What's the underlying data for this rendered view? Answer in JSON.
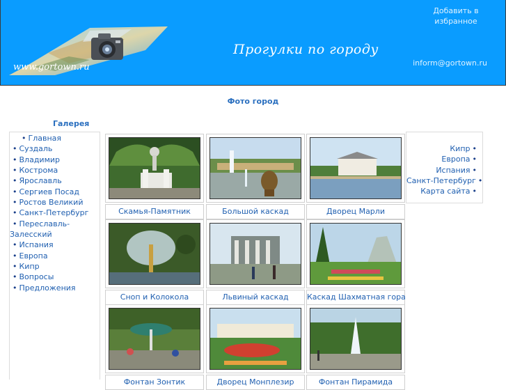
{
  "header": {
    "logo_text": "www.gortown.ru",
    "site_title": "Прогулки по городу",
    "favorite_link": "Добавить в избранное",
    "email_link": "inform@gortown.ru"
  },
  "main": {
    "page_heading": "Фото город",
    "gallery_heading": "Галерея"
  },
  "left_nav": {
    "items": [
      {
        "label": "Главная"
      },
      {
        "label": "Суздаль"
      },
      {
        "label": "Владимир"
      },
      {
        "label": "Кострома"
      },
      {
        "label": "Ярославль"
      },
      {
        "label": "Сергиев Посад"
      },
      {
        "label": "Ростов Великий"
      },
      {
        "label": "Санкт-Петербург"
      },
      {
        "label": "Переславль-Залесский"
      },
      {
        "label": "Испания"
      },
      {
        "label": "Европа"
      },
      {
        "label": "Кипр"
      },
      {
        "label": "Вопросы"
      },
      {
        "label": "Предложения"
      }
    ]
  },
  "right_nav": {
    "items": [
      {
        "label": "Кипр"
      },
      {
        "label": "Европа"
      },
      {
        "label": "Испания"
      },
      {
        "label": "Санкт-Петербург"
      },
      {
        "label": "Карта сайта"
      }
    ]
  },
  "gallery": {
    "photos": [
      {
        "caption": "Скамья-Памятник"
      },
      {
        "caption": "Большой каскад"
      },
      {
        "caption": "Дворец Марли"
      },
      {
        "caption": "Сноп и Колокола"
      },
      {
        "caption": "Львиный каскад"
      },
      {
        "caption": "Каскад Шахматная гора"
      },
      {
        "caption": "Фонтан Зонтик"
      },
      {
        "caption": "Дворец Монплезир"
      },
      {
        "caption": "Фонтан Пирамида"
      }
    ]
  },
  "colors": {
    "banner": "#0a9cff",
    "link": "#1f5fb0",
    "heading": "#2a6fbf"
  }
}
